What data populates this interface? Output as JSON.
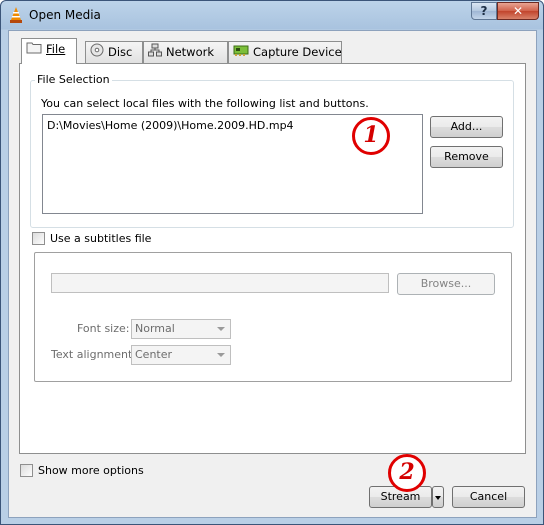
{
  "window": {
    "title": "Open Media",
    "help_glyph": "?",
    "close_glyph": "✕"
  },
  "tabs": [
    {
      "label": "File",
      "icon": "folder-icon",
      "active": true
    },
    {
      "label": "Disc",
      "icon": "disc-icon",
      "active": false
    },
    {
      "label": "Network",
      "icon": "network-icon",
      "active": false
    },
    {
      "label": "Capture Device",
      "icon": "capture-card-icon",
      "active": false
    }
  ],
  "file_selection": {
    "group_title": "File Selection",
    "description": "You can select local files with the following list and buttons.",
    "files": [
      "D:\\Movies\\Home (2009)\\Home.2009.HD.mp4"
    ],
    "add_label": "Add...",
    "remove_label": "Remove"
  },
  "subtitles": {
    "checkbox_label": "Use a subtitles file",
    "checked": false,
    "browse_label": "Browse...",
    "font_size_label": "Font size:",
    "font_size_value": "Normal",
    "alignment_label": "Text alignment:",
    "alignment_value": "Center"
  },
  "footer": {
    "show_more_label": "Show more options",
    "show_more_checked": false,
    "stream_label": "Stream",
    "cancel_label": "Cancel"
  },
  "annotations": [
    {
      "label": "1",
      "color": "#e00000"
    },
    {
      "label": "2",
      "color": "#e00000"
    }
  ]
}
